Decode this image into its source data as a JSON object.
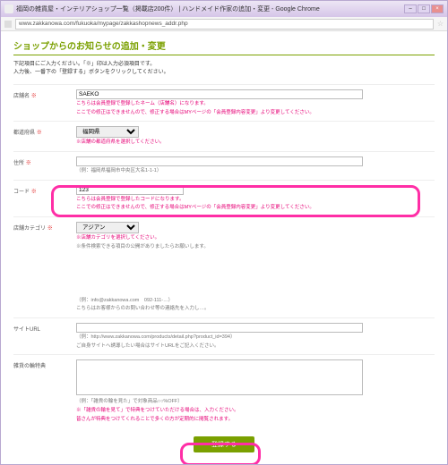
{
  "window": {
    "title": "福岡の雑貨屋・インテリアショップ一覧（掲載店200件） | ハンドメイド作家の追加・変更 - Google Chrome",
    "url": "www.zakkanowa.com/fukuoka/mypage/zakkashopnews_addr.php"
  },
  "page": {
    "heading": "ショップからのお知らせの追加・変更",
    "intro1": "下記項目にご入力ください。「※」印は入力必須項目です。",
    "intro2": "入力後、一番下の「登録する」ボタンをクリックしてください。"
  },
  "rows": {
    "shopname": {
      "label": "店舗名",
      "req": "※",
      "value": "SAEKO",
      "warn1": "こちらは会員登録で登録したネーム（店舗名）になります。",
      "warn2": "ここでの修正はできませんので、修正する場合はMYページの「会員登録内容変更」より変更してください。"
    },
    "pref": {
      "label": "都道府県",
      "req": "※",
      "value": "福岡県",
      "warn": "※店舗の都道府県を選択してください。"
    },
    "address": {
      "label": "住所",
      "req": "※",
      "hint": "（例：福岡県福岡市中央区大名1-1-1）"
    },
    "code": {
      "label": "コード",
      "req": "※",
      "value": "123",
      "warn1": "こちらは会員登録で登録したコードになります。",
      "warn2": "ここでの修正はできませんので、修正する場合はMYページの「会員登録内容変更」より変更してください。"
    },
    "category": {
      "label": "店舗カテゴリ",
      "req": "※",
      "value": "アジアン",
      "warn1": "※店舗カテゴリを選択してください。",
      "hint": "※条件検索できる項目の公開がありましたらお願いします。"
    },
    "email": {
      "label": "",
      "hint": "（例：info@zakkanowa.com　092-111-…）",
      "note": "こちらはお客様からのお問い合わせ等の連絡先を入力し…。"
    },
    "siteurl": {
      "label": "サイトURL",
      "hint": "（例：http://www.zakkanowa.com/products/detail.php?product_id=394）",
      "note": "ご自身サイトへ誘導したい場合はサイトURLをご記入ください。"
    },
    "bonus": {
      "label": "雑貨の輪特典",
      "hint": "（例：「雑貨の輪を見た」で対象商品○○%OFF）",
      "warn1": "※「雑貨の輪を見て」で特典をつけていただける場合は、入力ください。",
      "warn2": "皆さんが特典をつけてくれることで多くの方が定期的に閲覧されます。"
    }
  },
  "submit": {
    "label": "登録する"
  }
}
